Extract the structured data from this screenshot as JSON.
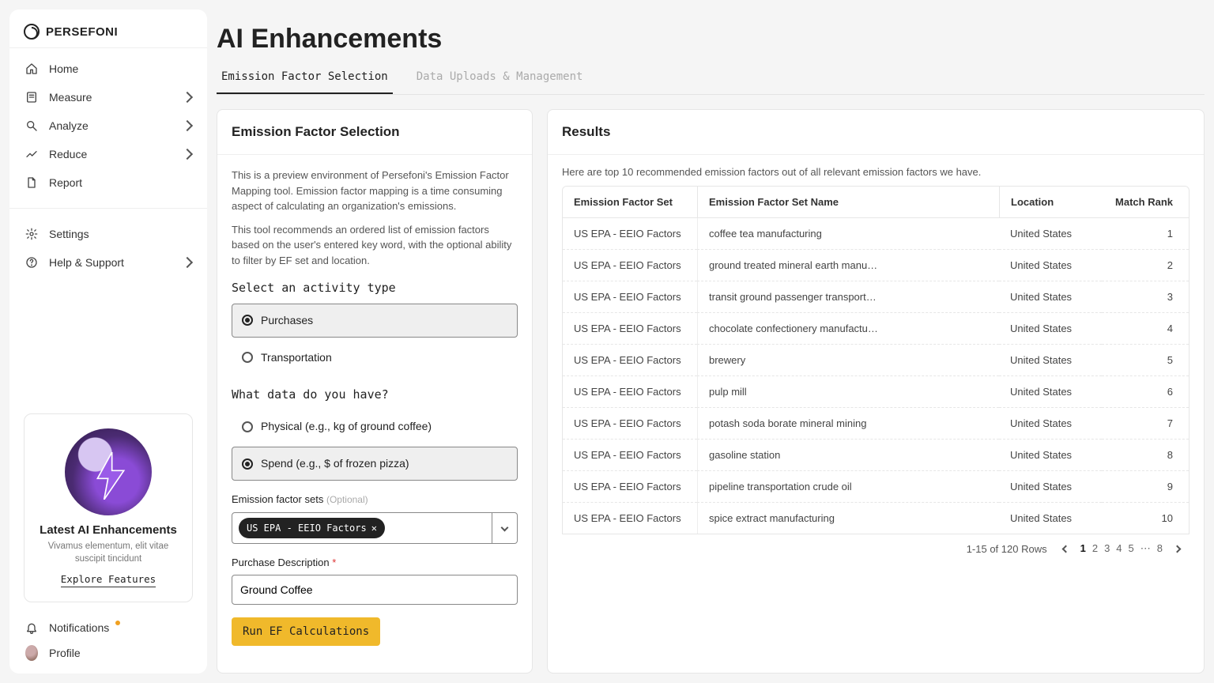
{
  "brand": "PERSEFONI",
  "sidebar": {
    "items": [
      {
        "icon": "home",
        "label": "Home",
        "chevron": false
      },
      {
        "icon": "gauge",
        "label": "Measure",
        "chevron": true
      },
      {
        "icon": "search",
        "label": "Analyze",
        "chevron": true
      },
      {
        "icon": "trend",
        "label": "Reduce",
        "chevron": true
      },
      {
        "icon": "doc",
        "label": "Report",
        "chevron": false
      }
    ],
    "secondary": [
      {
        "icon": "gear",
        "label": "Settings",
        "chevron": false
      },
      {
        "icon": "help",
        "label": "Help & Support",
        "chevron": true
      }
    ],
    "promo": {
      "title": "Latest AI Enhancements",
      "desc": "Vivamus elementum, elit vitae suscipit tincidunt",
      "cta": "Explore Features"
    },
    "footer": [
      {
        "icon": "bell",
        "label": "Notifications"
      },
      {
        "icon": "avatar",
        "label": "Profile"
      }
    ]
  },
  "page": {
    "title": "AI Enhancements",
    "tabs": [
      {
        "label": "Emission Factor Selection",
        "active": true
      },
      {
        "label": "Data Uploads & Management",
        "active": false
      }
    ]
  },
  "form": {
    "header": "Emission Factor Selection",
    "p1": "This is a preview environment of Persefoni's Emission Factor Mapping tool. Emission factor mapping is a time consuming aspect of calculating an organization's emissions.",
    "p2": "This tool recommends an ordered list of emission factors based on the user's entered key word, with the optional ability to filter by EF set and location.",
    "activity_label": "Select an activity type",
    "activity_options": [
      "Purchases",
      "Transportation"
    ],
    "activity_selected": 0,
    "data_label": "What data do you have?",
    "data_options": [
      "Physical (e.g., kg of ground coffee)",
      "Spend (e.g., $ of frozen pizza)"
    ],
    "data_selected": 1,
    "efset_label": "Emission factor sets",
    "efset_optional": "(Optional)",
    "efset_chip": "US EPA - EEIO Factors",
    "desc_label": "Purchase Description",
    "desc_value": "Ground Coffee",
    "run_label": "Run EF Calculations"
  },
  "results": {
    "header": "Results",
    "desc": "Here are top 10 recommended emission factors out of all relevant emission factors we have.",
    "columns": [
      "Emission Factor Set",
      "Emission Factor Set Name",
      "Location",
      "Match Rank"
    ],
    "rows": [
      {
        "set": "US EPA - EEIO Factors",
        "name": "coffee tea manufacturing",
        "loc": "United States",
        "rank": 1
      },
      {
        "set": "US EPA - EEIO Factors",
        "name": "ground treated mineral earth manu…",
        "loc": "United States",
        "rank": 2
      },
      {
        "set": "US EPA - EEIO Factors",
        "name": "transit ground passenger transport…",
        "loc": "United States",
        "rank": 3
      },
      {
        "set": "US EPA - EEIO Factors",
        "name": "chocolate confectionery manufactu…",
        "loc": "United States",
        "rank": 4
      },
      {
        "set": "US EPA - EEIO Factors",
        "name": "brewery",
        "loc": "United States",
        "rank": 5
      },
      {
        "set": "US EPA - EEIO Factors",
        "name": "pulp mill",
        "loc": "United States",
        "rank": 6
      },
      {
        "set": "US EPA - EEIO Factors",
        "name": "potash soda borate mineral mining",
        "loc": "United States",
        "rank": 7
      },
      {
        "set": "US EPA - EEIO Factors",
        "name": "gasoline station",
        "loc": "United States",
        "rank": 8
      },
      {
        "set": "US EPA - EEIO Factors",
        "name": "pipeline transportation crude oil",
        "loc": "United States",
        "rank": 9
      },
      {
        "set": "US EPA - EEIO Factors",
        "name": "spice extract manufacturing",
        "loc": "United States",
        "rank": 10
      }
    ],
    "pagination": {
      "summary": "1-15 of 120 Rows",
      "pages": [
        "1",
        "2",
        "3",
        "4",
        "5",
        "⋯",
        "8"
      ],
      "active": 0
    }
  }
}
